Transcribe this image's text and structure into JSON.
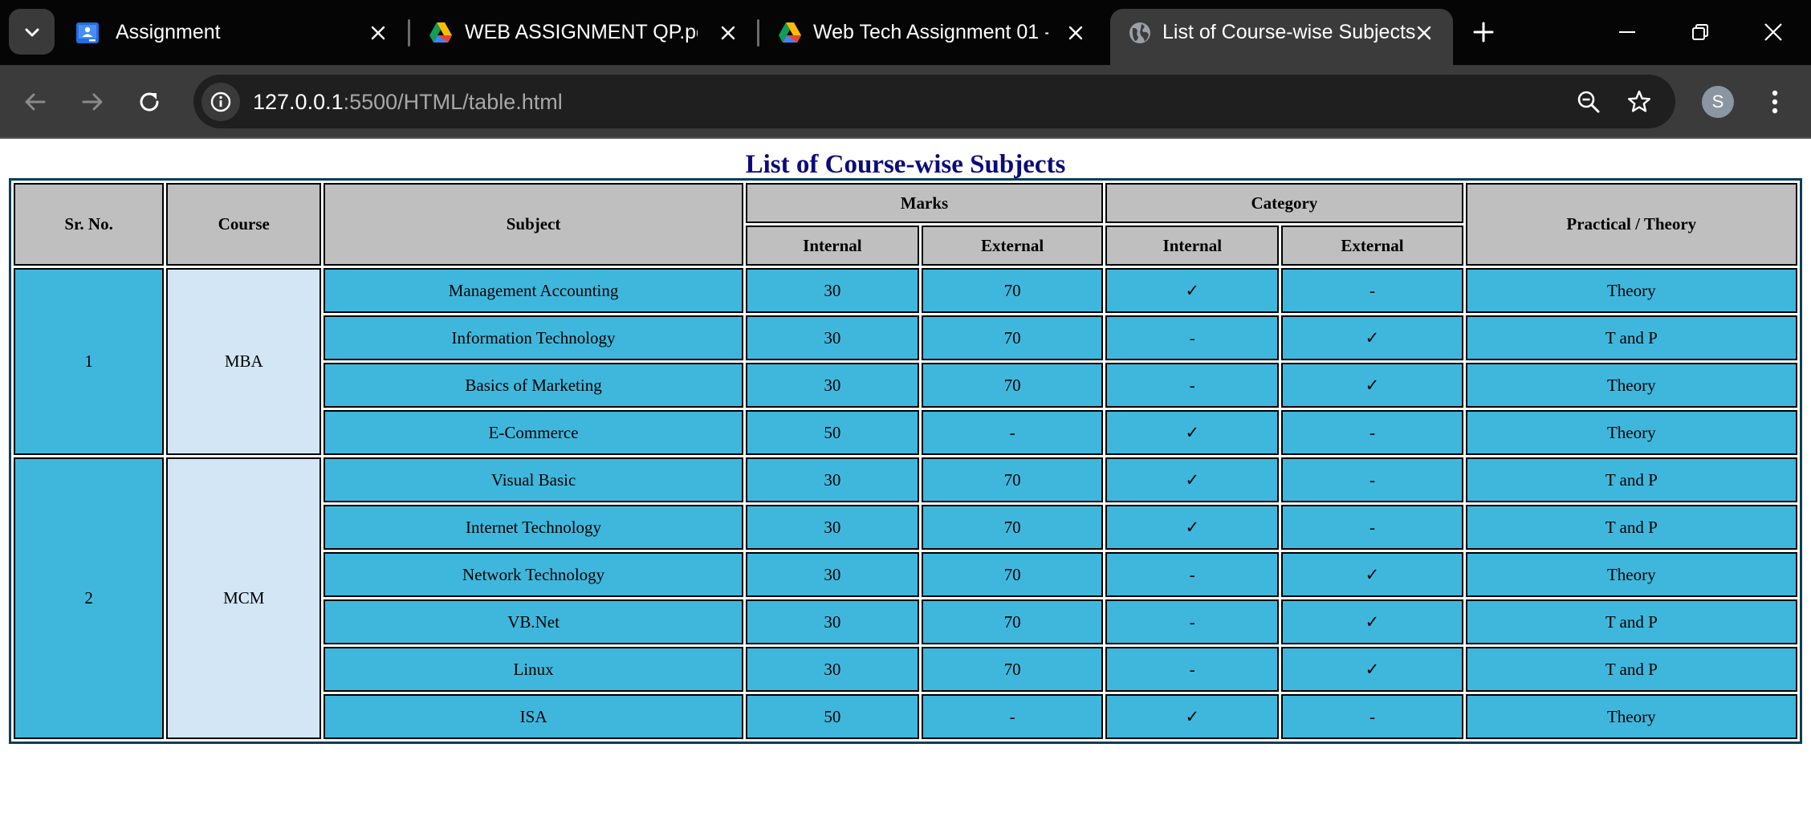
{
  "tabs": [
    {
      "title": "Assignment",
      "icon": "google-classroom-icon",
      "active": false
    },
    {
      "title": "WEB ASSIGNMENT QP.pdf - ",
      "icon": "google-drive-icon",
      "active": false
    },
    {
      "title": "Web Tech Assignment 01 - ",
      "icon": "google-drive-icon",
      "active": false
    },
    {
      "title": "List of Course-wise Subjects",
      "icon": "globe-icon",
      "active": true
    }
  ],
  "toolbar": {
    "url_host": "127.0.0.1",
    "url_path": ":5500/HTML/table.html",
    "avatar_letter": "S"
  },
  "page": {
    "title": "List of Course-wise Subjects",
    "headers": {
      "sr_no": "Sr. No.",
      "course": "Course",
      "subject": "Subject",
      "marks": "Marks",
      "category": "Category",
      "practical_theory": "Practical / Theory",
      "marks_internal": "Internal",
      "marks_external": "External",
      "category_internal": "Internal",
      "category_external": "External"
    },
    "groups": [
      {
        "sr_no": "1",
        "course": "MBA",
        "rows": [
          {
            "subject": "Management Accounting",
            "internal": "30",
            "external": "70",
            "cat_internal": "✓",
            "cat_external": "-",
            "type": "Theory"
          },
          {
            "subject": "Information Technology",
            "internal": "30",
            "external": "70",
            "cat_internal": "-",
            "cat_external": "✓",
            "type": "T and P"
          },
          {
            "subject": "Basics of Marketing",
            "internal": "30",
            "external": "70",
            "cat_internal": "-",
            "cat_external": "✓",
            "type": "Theory"
          },
          {
            "subject": "E-Commerce",
            "internal": "50",
            "external": "-",
            "cat_internal": "✓",
            "cat_external": "-",
            "type": "Theory"
          }
        ]
      },
      {
        "sr_no": "2",
        "course": "MCM",
        "rows": [
          {
            "subject": "Visual Basic",
            "internal": "30",
            "external": "70",
            "cat_internal": "✓",
            "cat_external": "-",
            "type": "T and P"
          },
          {
            "subject": "Internet Technology",
            "internal": "30",
            "external": "70",
            "cat_internal": "✓",
            "cat_external": "-",
            "type": "T and P"
          },
          {
            "subject": "Network Technology",
            "internal": "30",
            "external": "70",
            "cat_internal": "-",
            "cat_external": "✓",
            "type": "Theory"
          },
          {
            "subject": "VB.Net",
            "internal": "30",
            "external": "70",
            "cat_internal": "-",
            "cat_external": "✓",
            "type": "T and P"
          },
          {
            "subject": "Linux",
            "internal": "30",
            "external": "70",
            "cat_internal": "-",
            "cat_external": "✓",
            "type": "T and P"
          },
          {
            "subject": "ISA",
            "internal": "50",
            "external": "-",
            "cat_internal": "✓",
            "cat_external": "-",
            "type": "Theory"
          }
        ]
      }
    ]
  },
  "colors": {
    "tab_strip": "#050505",
    "toolbar": "#3b3b3b",
    "title": "#0b0b7a",
    "header_cell": "#bfbfbf",
    "data_cell": "#3fb7dc",
    "course_cell": "#d2e6f6"
  }
}
